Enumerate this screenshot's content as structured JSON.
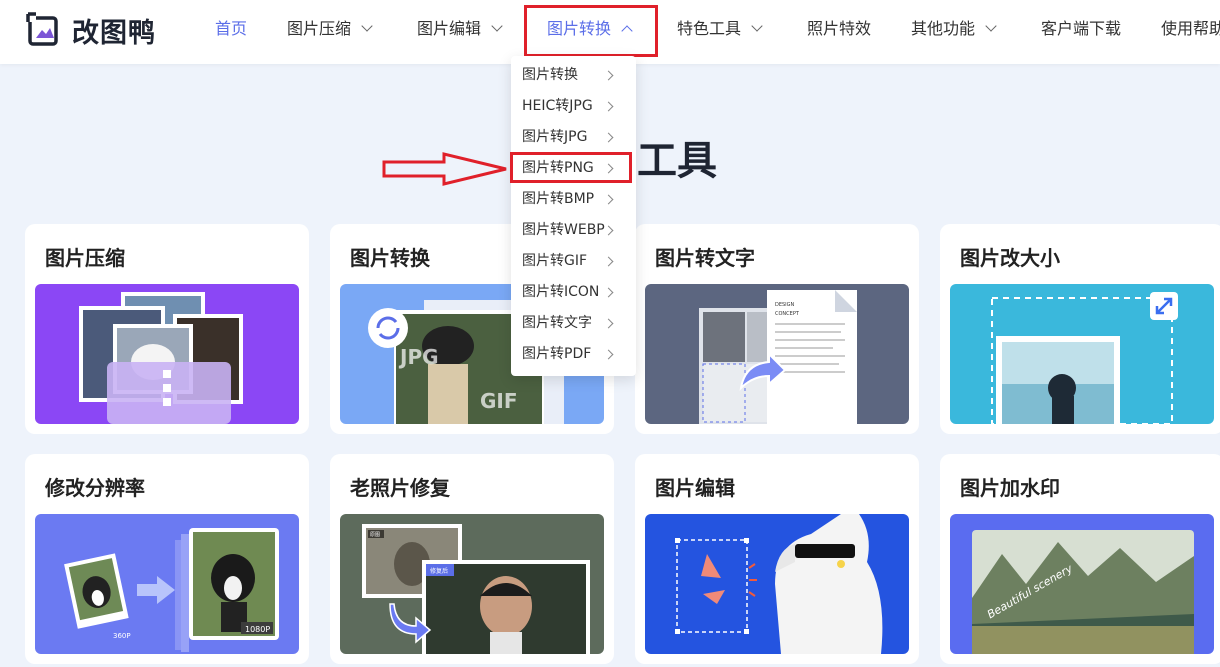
{
  "brand": {
    "name": "改图鸭"
  },
  "nav": [
    {
      "label": "首页",
      "has_chevron": false,
      "state": "active"
    },
    {
      "label": "图片压缩",
      "has_chevron": true,
      "state": ""
    },
    {
      "label": "图片编辑",
      "has_chevron": true,
      "state": ""
    },
    {
      "label": "图片转换",
      "has_chevron": true,
      "state": "open"
    },
    {
      "label": "特色工具",
      "has_chevron": true,
      "state": ""
    },
    {
      "label": "照片特效",
      "has_chevron": false,
      "state": ""
    },
    {
      "label": "其他功能",
      "has_chevron": true,
      "state": ""
    },
    {
      "label": "客户端下载",
      "has_chevron": false,
      "state": ""
    },
    {
      "label": "使用帮助",
      "has_chevron": false,
      "state": ""
    }
  ],
  "dropdown": [
    "图片转换",
    "HEIC转JPG",
    "图片转JPG",
    "图片转PNG",
    "图片转BMP",
    "图片转WEBP",
    "图片转GIF",
    "图片转ICON",
    "图片转文字",
    "图片转PDF"
  ],
  "page_title_visible": "工具",
  "cards": [
    {
      "title": "图片压缩"
    },
    {
      "title": "图片转换"
    },
    {
      "title": "图片转文字"
    },
    {
      "title": "图片改大小"
    },
    {
      "title": "修改分辨率"
    },
    {
      "title": "老照片修复"
    },
    {
      "title": "图片编辑"
    },
    {
      "title": "图片加水印"
    }
  ],
  "card_texts": {
    "convert_jpg": "JPG",
    "convert_gif": "GIF",
    "doc_design": "DESIGN",
    "doc_concept": "CONCEPT",
    "res_low": "360P",
    "res_high": "1080P",
    "old_before": "原图",
    "old_after": "修复后",
    "watermark_text": "Beautiful scenery"
  },
  "colors": {
    "accent": "#5b6ee8",
    "highlight_red": "#e0202a",
    "page_bg": "#eef3fb"
  }
}
